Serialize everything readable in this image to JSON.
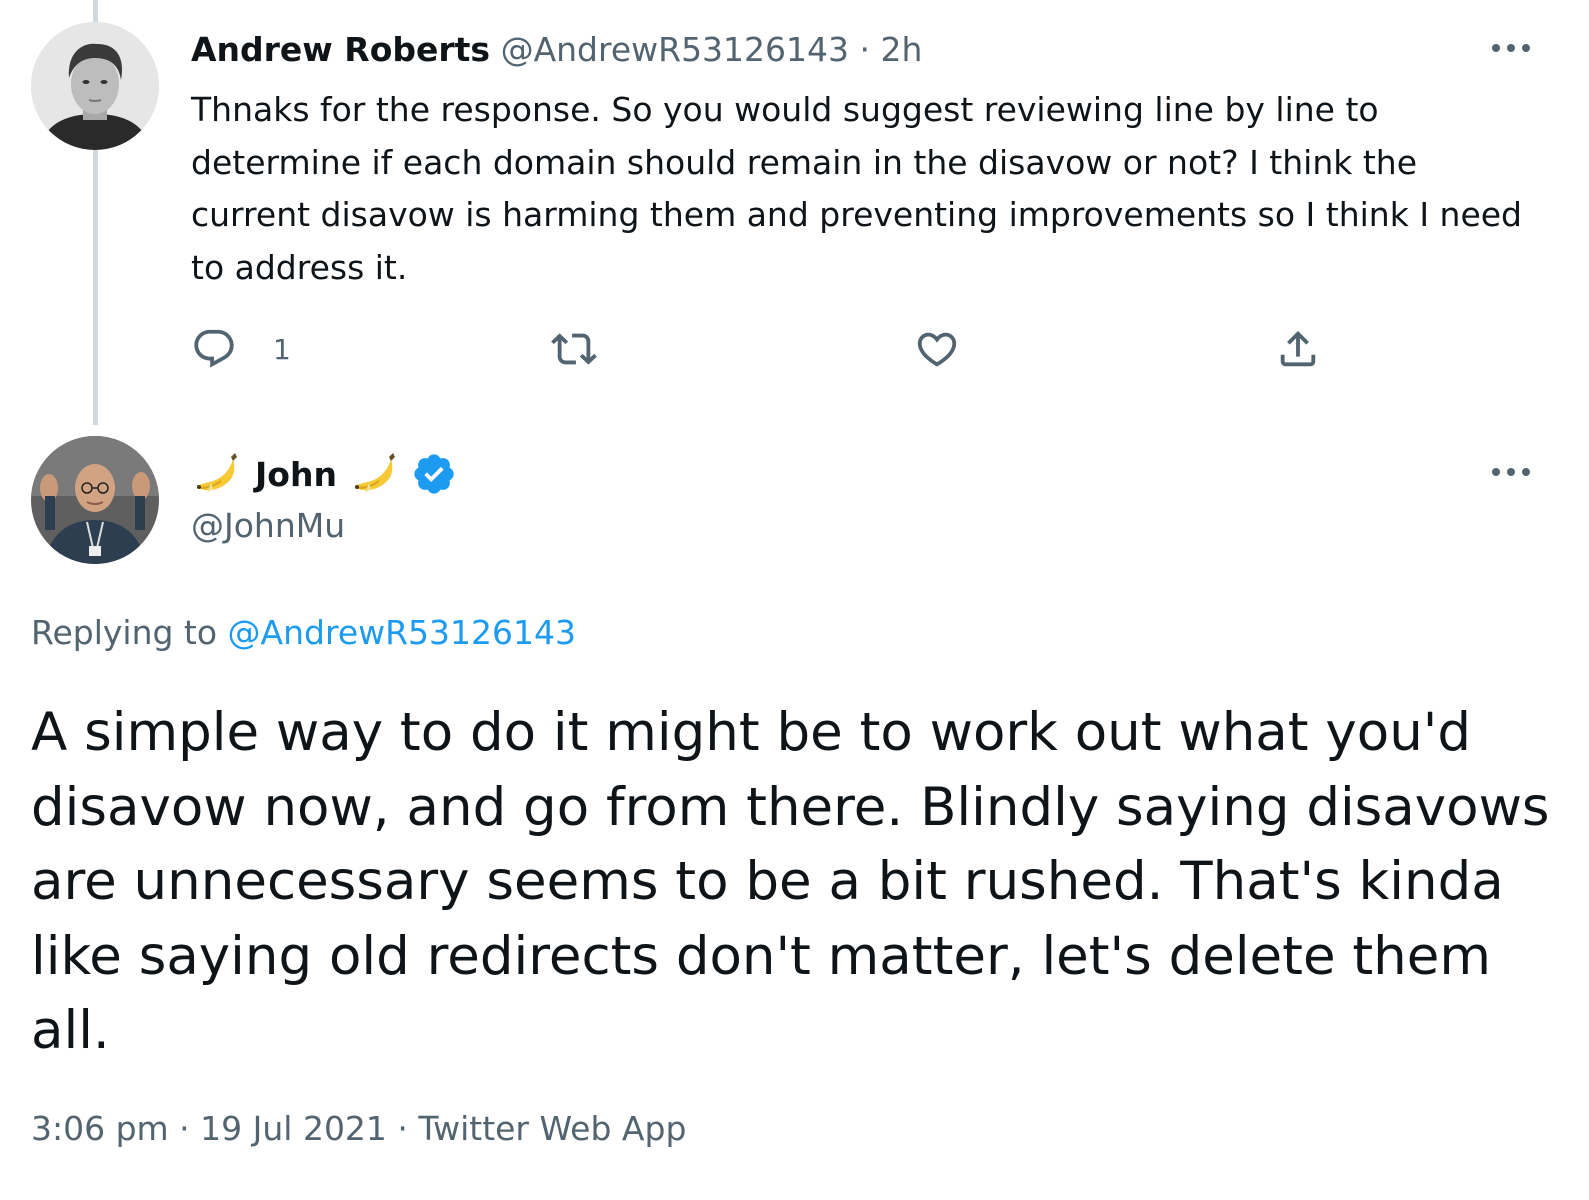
{
  "parent_tweet": {
    "display_name": "Andrew Roberts",
    "handle": "@AndrewR53126143",
    "separator": "·",
    "time": "2h",
    "text": "Thnaks for the response. So you would suggest reviewing line by line to determine if each domain should remain in the disavow or not? I think the current disavow is harming them and preventing improvements so I think I need to address it.",
    "actions": {
      "reply_count": "1",
      "reply_icon": "reply-icon",
      "retweet_icon": "retweet-icon",
      "like_icon": "heart-icon",
      "share_icon": "share-icon"
    }
  },
  "main_tweet": {
    "display_name": "John",
    "name_emoji": "banana",
    "verified": true,
    "handle": "@JohnMu",
    "replying_label": "Replying to",
    "replying_to": "@AndrewR53126143",
    "text": "A simple way to do it might be to work out what you'd disavow now, and go from there. Blindly saying disavows are unnecessary seems to be a bit rushed. That's kinda like saying old redirects don't matter, let's delete them all.",
    "meta": "3:06 pm · 19 Jul 2021 · Twitter Web App"
  },
  "colors": {
    "text_primary": "#0f1419",
    "text_secondary": "#536471",
    "link": "#1d9bf0",
    "thread_line": "#cfd9de",
    "verified_badge": "#1d9bf0"
  }
}
